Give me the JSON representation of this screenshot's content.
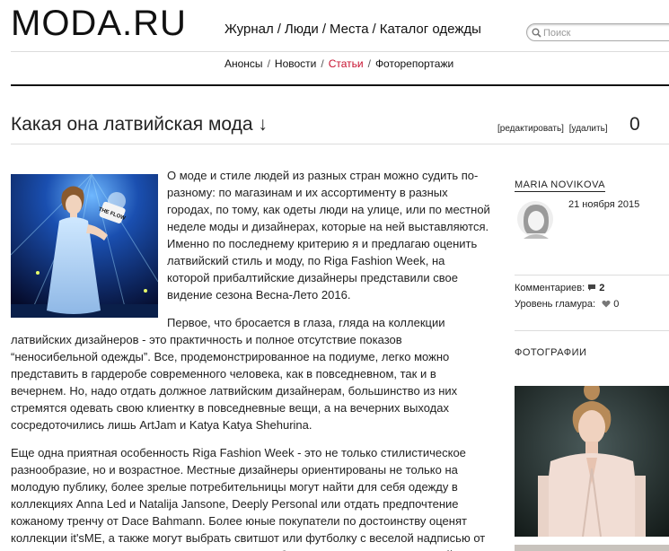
{
  "header": {
    "logo": "MODA.RU",
    "nav": [
      "Журнал",
      "Люди",
      "Места",
      "Каталог одежды"
    ],
    "nav_sep": "/",
    "search": {
      "placeholder": "Поиск",
      "icon": "search-icon"
    }
  },
  "subnav": {
    "items": [
      "Анонсы",
      "Новости",
      "Статьи",
      "Фоторепортажи"
    ],
    "active": "Статьи",
    "active_color": "#c7102e"
  },
  "article": {
    "title": "Какая она латвийская мода ↓",
    "edit_link": "[редактировать]",
    "delete_link": "[удалить]",
    "count": "0",
    "paragraphs": [
      "О моде и стиле людей из разных стран можно судить по-разному: по магазинам и их ассортименту в разных городах, по тому, как одеты люди на улице, или по местной неделе моды и дизайнерах, которые на ней выставляются. Именно по последнему критерию я и предлагаю оценить латвийский стиль и моду, по Riga Fashion Week, на которой прибалтийские дизайнеры представили свое видение сезона Весна-Лето 2016.",
      "Первое, что бросается в глаза, гляда на коллекции латвийских дизайнеров - это практичность и полное отсутствие показов “неносибельной одежды”. Все, продемонстрированное на подиуме, легко можно представить в гардеробе современного человека, как в повседневном, так и в вечернем. Но, надо отдать должное латвийским дизайнерам, большинство из них стремятся одевать свою клиентку в повседневные вещи, а на вечерних выходах сосредоточились лишь ArtJam и Katya Katya Shehurina.",
      "Еще одна приятная особенность Riga Fashion Week - это не только стилистическое разнообразие, но и возрастное. Местные дизайнеры ориентированы не только на молодую публику, более зрелые потребительницы могут найти для себя одежду в коллекциях Anna Led и Natalija Jansone, Deeply Personal или отдать предпочтение кожаному тренчу от Dace Bahmann. Более юные покупатели по достоинству оценят коллекции it'sME, а также могут выбрать свитшот или футболку с веселой надписью от QooQoo по демократичным ценам, которыми вообще отличаются местных дизайнеров."
    ],
    "photo_sign": "THE FLOW"
  },
  "sidebar": {
    "author": "MARIA NOVIKOVA",
    "date": "21 ноября 2015",
    "comments_label": "Комментариев:",
    "comments_value": "2",
    "glamour_label": "Уровень гламура:",
    "glamour_value": "0",
    "photos_heading": "ФОТОГРАФИИ"
  }
}
